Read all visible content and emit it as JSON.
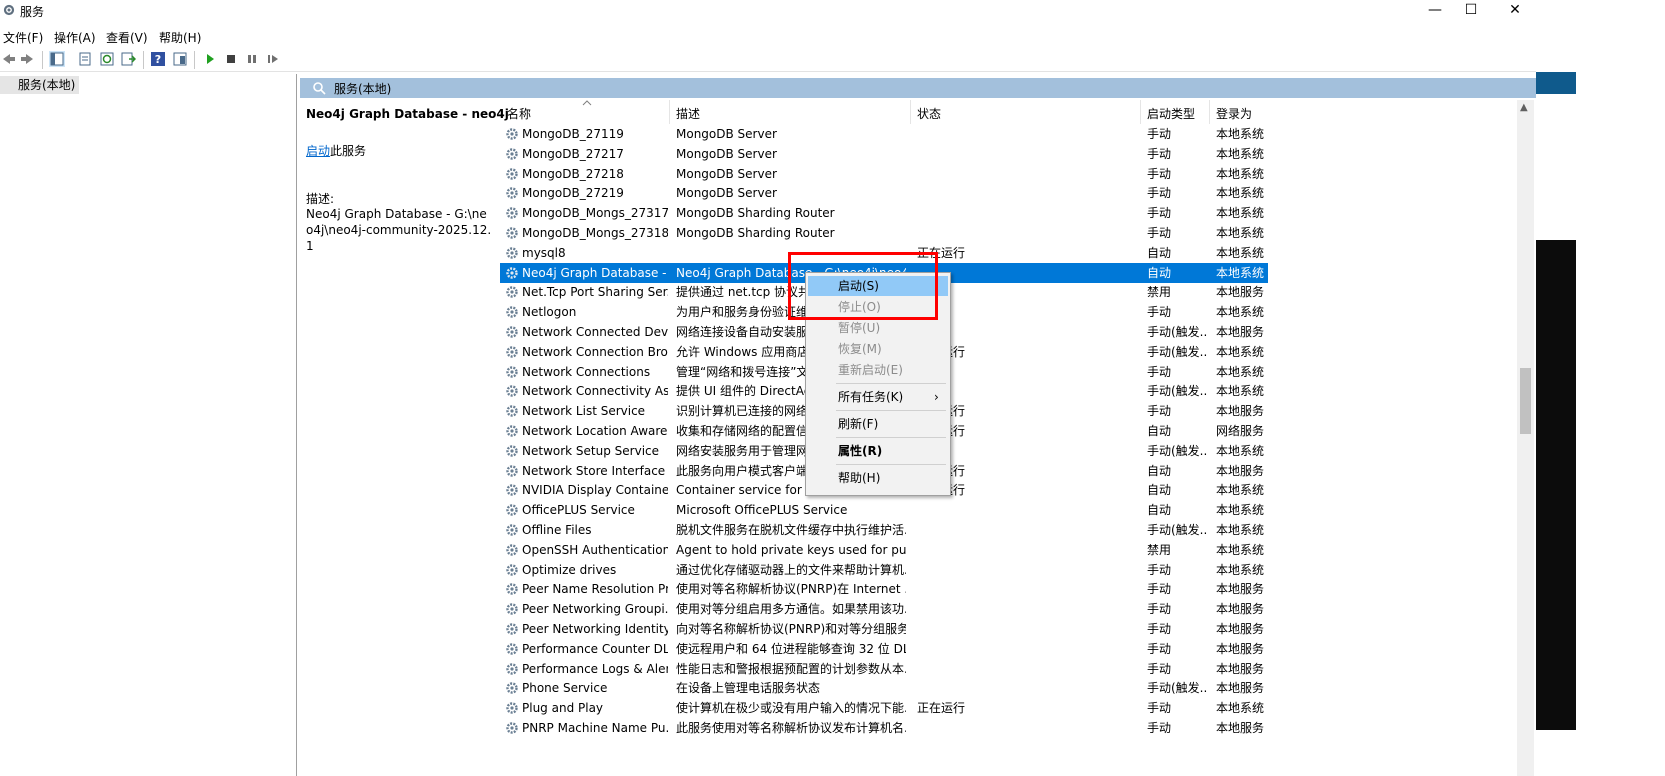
{
  "window": {
    "title": "服务",
    "minimize": "—",
    "maximize": "☐",
    "close": "✕"
  },
  "menu": [
    "文件(F)",
    "操作(A)",
    "查看(V)",
    "帮助(H)"
  ],
  "tree": {
    "root_label": "服务(本地)"
  },
  "header": {
    "label": "服务(本地)"
  },
  "desc_pane": {
    "service_title": "Neo4j Graph Database - neo4j",
    "start_link": "启动",
    "start_suffix": "此服务",
    "desc_label": "描述:",
    "desc_text": "Neo4j Graph Database - G:\\neo4j\\neo4j-community-2025.12.1"
  },
  "columns": {
    "name": "名称",
    "description": "描述",
    "status": "状态",
    "startup": "启动类型",
    "logon": "登录为"
  },
  "rows": [
    {
      "name": "MongoDB_27119",
      "desc": "MongoDB Server",
      "status": "",
      "startup": "手动",
      "logon": "本地系统"
    },
    {
      "name": "MongoDB_27217",
      "desc": "MongoDB Server",
      "status": "",
      "startup": "手动",
      "logon": "本地系统"
    },
    {
      "name": "MongoDB_27218",
      "desc": "MongoDB Server",
      "status": "",
      "startup": "手动",
      "logon": "本地系统"
    },
    {
      "name": "MongoDB_27219",
      "desc": "MongoDB Server",
      "status": "",
      "startup": "手动",
      "logon": "本地系统"
    },
    {
      "name": "MongoDB_Mongs_27317",
      "desc": "MongoDB Sharding Router",
      "status": "",
      "startup": "手动",
      "logon": "本地系统"
    },
    {
      "name": "MongoDB_Mongs_27318",
      "desc": "MongoDB Sharding Router",
      "status": "",
      "startup": "手动",
      "logon": "本地系统"
    },
    {
      "name": "mysql8",
      "desc": "",
      "status": "正在运行",
      "startup": "自动",
      "logon": "本地系统"
    },
    {
      "name": "Neo4j Graph Database - ...",
      "desc": "Neo4j Graph Database - G:\\neo4j\\neo4j...",
      "status": "",
      "startup": "自动",
      "logon": "本地系统",
      "selected": true
    },
    {
      "name": "Net.Tcp Port Sharing Ser...",
      "desc": "提供通过 net.tcp 协议共享 TCP 端口的功能。",
      "status": "",
      "startup": "禁用",
      "logon": "本地服务"
    },
    {
      "name": "Netlogon",
      "desc": "为用户和服务身份验证维护此计算机和域控制器之间的安全通道...",
      "status": "",
      "startup": "手动",
      "logon": "本地系统"
    },
    {
      "name": "Network Connected Devi...",
      "desc": "网络连接设备自动安装服务会监视和安装连接到...",
      "status": "",
      "startup": "手动(触发...",
      "logon": "本地服务"
    },
    {
      "name": "Network Connection Bro...",
      "desc": "允许 Windows 应用商店应用从 Internet 接收...",
      "status": "正在运行",
      "startup": "手动(触发...",
      "logon": "本地系统"
    },
    {
      "name": "Network Connections",
      "desc": "管理“网络和拨号连接”文件夹中对象，在其中...",
      "status": "",
      "startup": "手动",
      "logon": "本地系统"
    },
    {
      "name": "Network Connectivity Ass...",
      "desc": "提供 UI 组件的 DirectAccess 状态通知",
      "status": "",
      "startup": "手动(触发...",
      "logon": "本地系统"
    },
    {
      "name": "Network List Service",
      "desc": "识别计算机已连接的网络，收集和存储这些网络...",
      "status": "正在运行",
      "startup": "手动",
      "logon": "本地服务"
    },
    {
      "name": "Network Location Aware...",
      "desc": "收集和存储网络的配置信息，并在此信息被修改...",
      "status": "正在运行",
      "startup": "自动",
      "logon": "网络服务"
    },
    {
      "name": "Network Setup Service",
      "desc": "网络安装服务用于管理网络驱动程序的安装...",
      "status": "",
      "startup": "手动(触发...",
      "logon": "本地系统"
    },
    {
      "name": "Network Store Interface ...",
      "desc": "此服务向用户模式客户端传递网络通知...",
      "status": "正在运行",
      "startup": "自动",
      "logon": "本地服务"
    },
    {
      "name": "NVIDIA Display Containe...",
      "desc": "Container service for NVIDIA root features",
      "status": "正在运行",
      "startup": "自动",
      "logon": "本地系统"
    },
    {
      "name": "OfficePLUS Service",
      "desc": "Microsoft OfficePLUS Service",
      "status": "",
      "startup": "自动",
      "logon": "本地系统"
    },
    {
      "name": "Offline Files",
      "desc": "脱机文件服务在脱机文件缓存中执行维护活...",
      "status": "",
      "startup": "手动(触发...",
      "logon": "本地系统"
    },
    {
      "name": "OpenSSH Authentication ...",
      "desc": "Agent to hold private keys used for pub...",
      "status": "",
      "startup": "禁用",
      "logon": "本地系统"
    },
    {
      "name": "Optimize drives",
      "desc": "通过优化存储驱动器上的文件来帮助计算机...",
      "status": "",
      "startup": "手动",
      "logon": "本地系统"
    },
    {
      "name": "Peer Name Resolution Pr...",
      "desc": "使用对等名称解析协议(PNRP)在 Internet ...",
      "status": "",
      "startup": "手动",
      "logon": "本地服务"
    },
    {
      "name": "Peer Networking Groupi...",
      "desc": "使用对等分组启用多方通信。如果禁用该功...",
      "status": "",
      "startup": "手动",
      "logon": "本地服务"
    },
    {
      "name": "Peer Networking Identity...",
      "desc": "向对等名称解析协议(PNRP)和对等分组服务...",
      "status": "",
      "startup": "手动",
      "logon": "本地服务"
    },
    {
      "name": "Performance Counter DL...",
      "desc": "使远程用户和 64 位进程能够查询 32 位 DL...",
      "status": "",
      "startup": "手动",
      "logon": "本地服务"
    },
    {
      "name": "Performance Logs & Aler...",
      "desc": "性能日志和警报根据预配置的计划参数从本...",
      "status": "",
      "startup": "手动",
      "logon": "本地服务"
    },
    {
      "name": "Phone Service",
      "desc": "在设备上管理电话服务状态",
      "status": "",
      "startup": "手动(触发...",
      "logon": "本地服务"
    },
    {
      "name": "Plug and Play",
      "desc": "使计算机在极少或没有用户输入的情况下能...",
      "status": "正在运行",
      "startup": "手动",
      "logon": "本地系统"
    },
    {
      "name": "PNRP Machine Name Pu...",
      "desc": "此服务使用对等名称解析协议发布计算机名...",
      "status": "",
      "startup": "手动",
      "logon": "本地服务"
    }
  ],
  "context_menu": {
    "start": "启动(S)",
    "stop": "停止(O)",
    "pause": "暂停(U)",
    "resume": "恢复(M)",
    "restart": "重新启动(E)",
    "all_tasks": "所有任务(K)",
    "refresh": "刷新(F)",
    "properties": "属性(R)",
    "help": "帮助(H)"
  },
  "colors": {
    "selection": "#0078d7",
    "header": "#a3c0dc",
    "highlight_box": "#ff0000",
    "menu_hover": "#91c9f7"
  }
}
